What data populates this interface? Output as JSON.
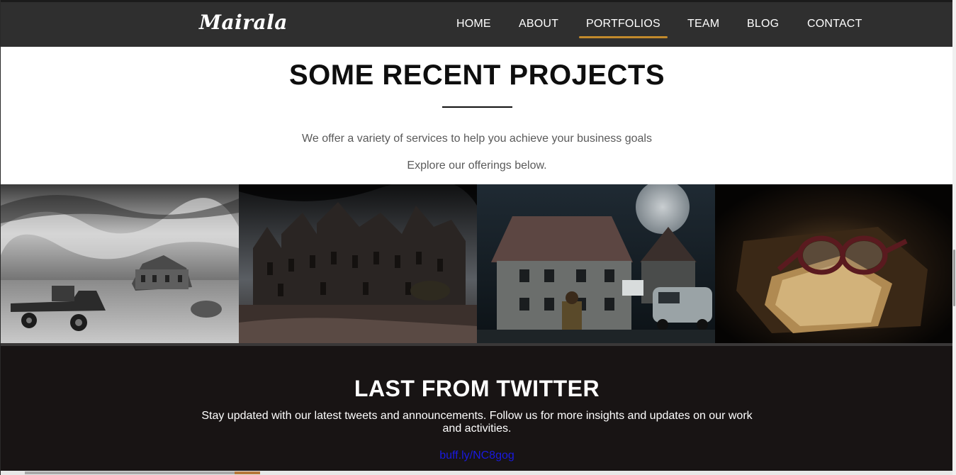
{
  "header": {
    "logo": "Mairala",
    "nav": [
      {
        "label": "HOME",
        "active": false
      },
      {
        "label": "ABOUT",
        "active": false
      },
      {
        "label": "PORTFOLIOS",
        "active": true
      },
      {
        "label": "TEAM",
        "active": false
      },
      {
        "label": "BLOG",
        "active": false
      },
      {
        "label": "CONTACT",
        "active": false
      }
    ],
    "accent_color": "#c28a2c"
  },
  "projects": {
    "title": "SOME RECENT PROJECTS",
    "subtitle_1": "We offer a variety of services to help you achieve your business goals",
    "subtitle_2": "Explore our offerings below.",
    "images": [
      {
        "name": "farmhouse-truck-photo"
      },
      {
        "name": "gothic-mansion-photo"
      },
      {
        "name": "haunted-house-moon-photo"
      },
      {
        "name": "glasses-old-book-photo"
      }
    ]
  },
  "twitter": {
    "title": "LAST FROM TWITTER",
    "text": "Stay updated with our latest tweets and announcements. Follow us for more insights and updates on our work and activities.",
    "link": "buff.ly/NC8gog",
    "link_color": "#1a1adf"
  }
}
